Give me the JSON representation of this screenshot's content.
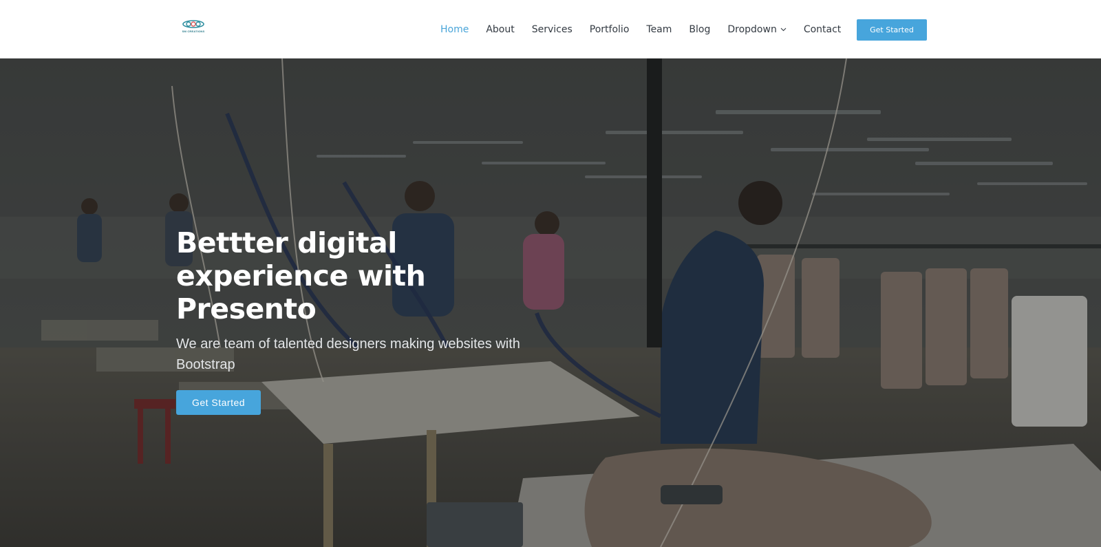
{
  "brand": {
    "logo_text": "SM CREATIONS"
  },
  "nav": {
    "items": [
      {
        "label": "Home",
        "active": true
      },
      {
        "label": "About"
      },
      {
        "label": "Services"
      },
      {
        "label": "Portfolio"
      },
      {
        "label": "Team"
      },
      {
        "label": "Blog"
      },
      {
        "label": "Dropdown",
        "icon": "chevron-down-icon"
      },
      {
        "label": "Contact"
      }
    ],
    "cta_label": "Get Started"
  },
  "hero": {
    "title": "Bettter digital experience with Presento",
    "subtitle": "We are team of talented designers making websites with Bootstrap",
    "cta_label": "Get Started"
  },
  "colors": {
    "accent": "#47a5dc",
    "nav_text": "#333a42",
    "nav_active": "#4aa5d9",
    "hero_text": "#ffffff"
  }
}
